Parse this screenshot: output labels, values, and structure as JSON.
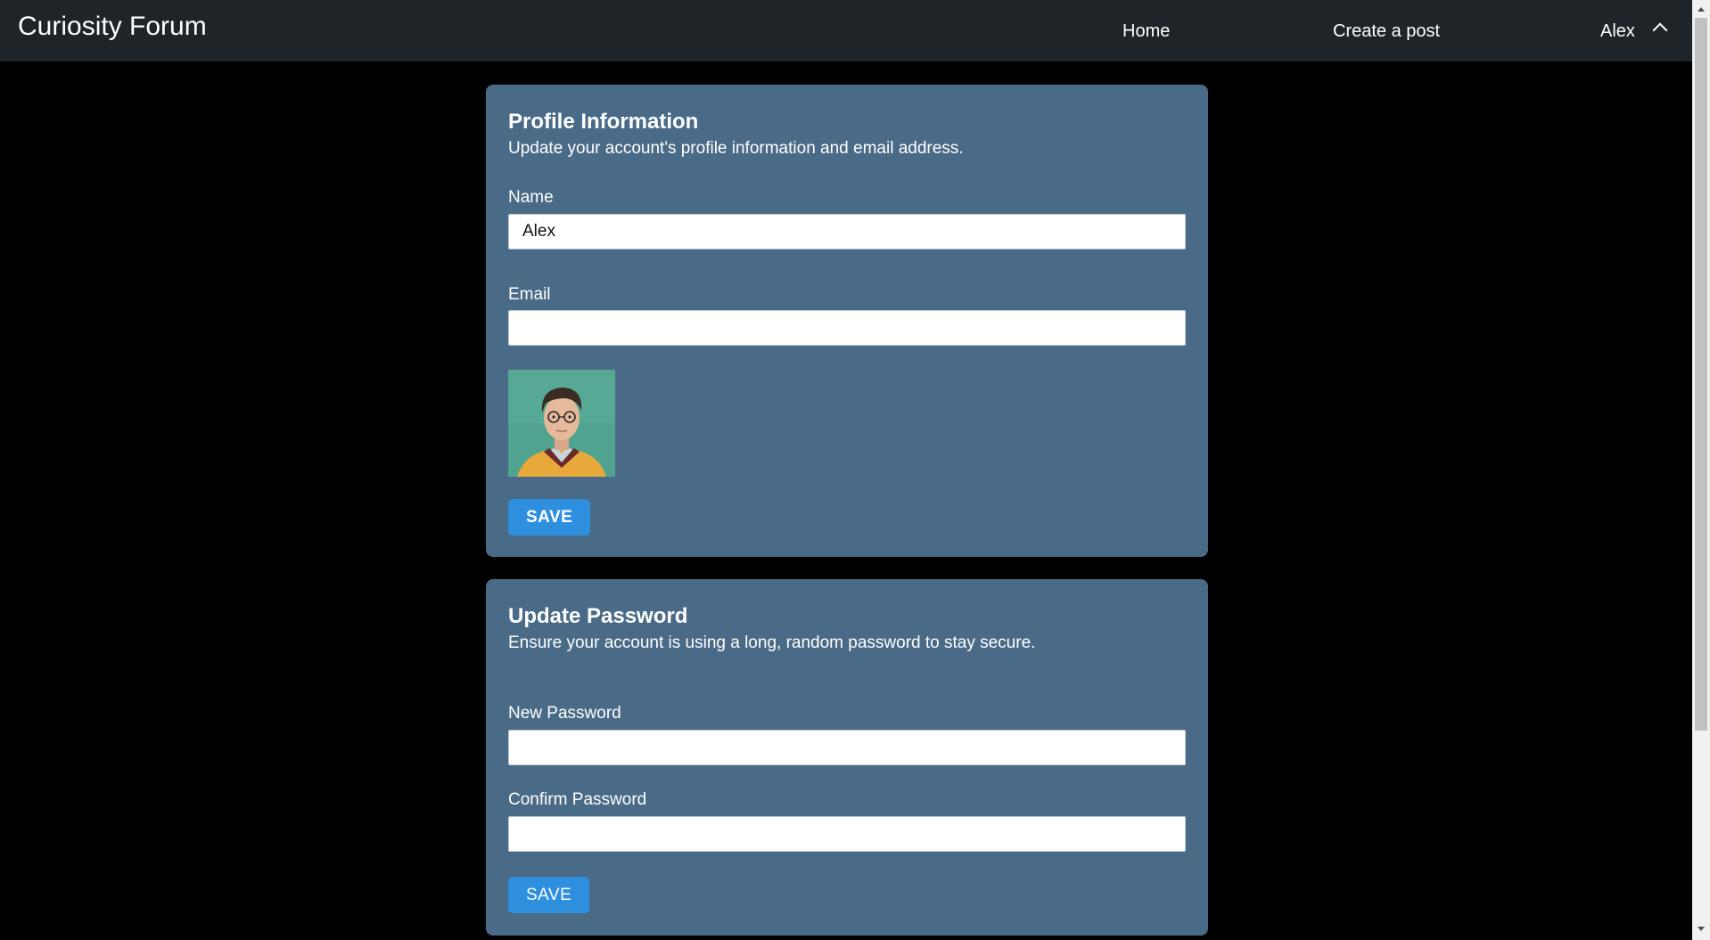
{
  "header": {
    "brand": "Curiosity Forum",
    "nav": {
      "home": "Home",
      "create_post": "Create a post",
      "user": "Alex"
    },
    "user_menu_icon": "chevron-up-icon"
  },
  "profile": {
    "title": "Profile Information",
    "description": "Update your account's profile information and email address.",
    "name_label": "Name",
    "name_value": "Alex",
    "email_label": "Email",
    "email_value": "",
    "avatar_alt": "avatar",
    "save_label": "SAVE"
  },
  "password": {
    "title": "Update Password",
    "description": "Ensure your account is using a long, random password to stay secure.",
    "new_label": "New Password",
    "new_value": "",
    "confirm_label": "Confirm Password",
    "confirm_value": "",
    "save_label": "SAVE"
  },
  "colors": {
    "page_background": "#000000",
    "header_background": "#1f2428",
    "card_background": "#4a6b87",
    "button_background": "#2f8fdf"
  }
}
